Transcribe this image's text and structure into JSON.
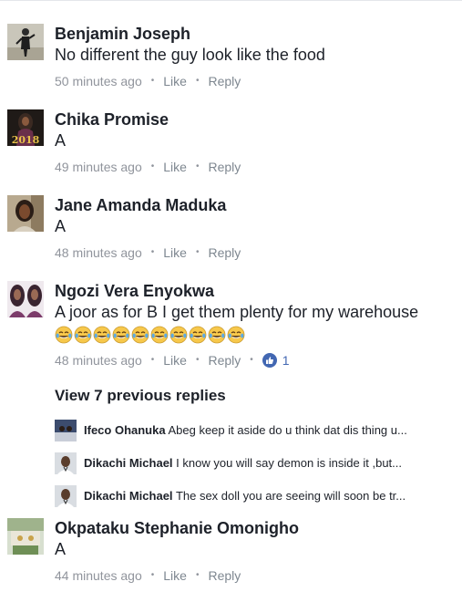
{
  "comments": [
    {
      "name": "Benjamin Joseph",
      "text": "No different the guy look like the food",
      "time": "50 minutes ago",
      "like": "Like",
      "reply": "Reply"
    },
    {
      "name": "Chika Promise",
      "text": "A",
      "time": "49 minutes ago",
      "like": "Like",
      "reply": "Reply",
      "avatar_caption": "2018"
    },
    {
      "name": "Jane Amanda Maduka",
      "text": "A",
      "time": "48 minutes ago",
      "like": "Like",
      "reply": "Reply"
    },
    {
      "name": "Ngozi Vera Enyokwa",
      "text": "A joor as for B I get them plenty for my warehouse",
      "emoji": "😂😂😂😂😂😂😂😂😂😂",
      "emoji_count": 10,
      "time": "48 minutes ago",
      "like": "Like",
      "reply": "Reply",
      "reaction_icon": "like-reaction-icon",
      "reaction_count": "1"
    },
    {
      "name": "Okpataku Stephanie Omonigho",
      "text": "A",
      "time": "44 minutes ago",
      "like": "Like",
      "reply": "Reply"
    }
  ],
  "view_replies": "View 7 previous replies",
  "replies": [
    {
      "name": "Ifeco Ohanuka",
      "text": "Abeg keep it aside do u think dat dis thing u..."
    },
    {
      "name": "Dikachi Michael",
      "text": "I know you will say demon is inside it ,but..."
    },
    {
      "name": "Dikachi Michael",
      "text": "The sex doll you are seeing will soon be tr..."
    }
  ],
  "separator": "•",
  "colors": {
    "name": "#1d2129",
    "meta": "#90949c",
    "like_blue": "#4267b2",
    "emoji_yellow": "#f7c84b"
  }
}
